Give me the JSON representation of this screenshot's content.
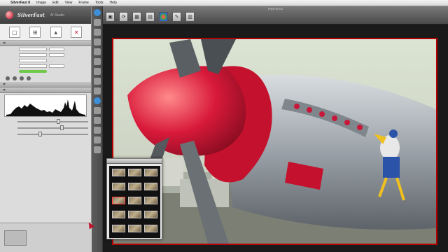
{
  "menubar": {
    "apple_glyph": "",
    "items": [
      "SilverFast 8",
      "Image",
      "Edit",
      "View",
      "Frame",
      "Tools",
      "Help"
    ]
  },
  "app": {
    "brand": "SilverFast",
    "brand_suffix": "Ai Studio",
    "window_title": "PrevPro 8.0"
  },
  "colors": {
    "frame_border": "#b30000",
    "accent_red": "#c0122a",
    "progress_green": "#6fca4a",
    "toolbar_dark": "#4a4a4a"
  },
  "left_tools": [
    {
      "icon": "scan-frame-icon",
      "glyph": "▢"
    },
    {
      "icon": "frame-select-icon",
      "glyph": "⊞"
    },
    {
      "icon": "histogram-tool-icon",
      "glyph": "▲"
    },
    {
      "icon": "pdf-icon",
      "glyph": "✕"
    }
  ],
  "top_tools": [
    {
      "icon": "prescan-icon",
      "glyph": "▣"
    },
    {
      "icon": "reset-icon",
      "glyph": "⟳"
    },
    {
      "icon": "image-icon",
      "glyph": "▦"
    },
    {
      "icon": "film-icon",
      "glyph": "▤"
    },
    {
      "icon": "color-wheel-icon",
      "glyph": ""
    },
    {
      "icon": "tools-icon",
      "glyph": "✎"
    },
    {
      "icon": "grid-icon",
      "glyph": "▥"
    }
  ]
}
